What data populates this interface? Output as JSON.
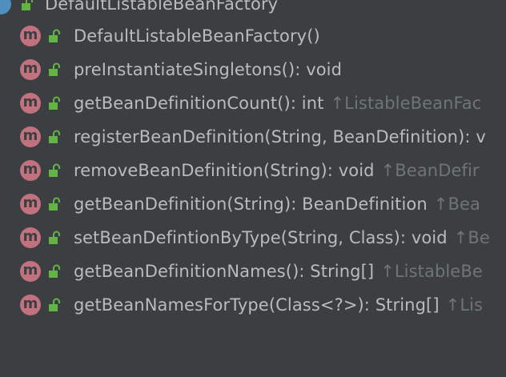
{
  "class_node": {
    "name": "DefaultListableBeanFactory",
    "icon": "class-icon"
  },
  "members": [
    {
      "signature": "DefaultListableBeanFactory()",
      "inherited": ""
    },
    {
      "signature": "preInstantiateSingletons(): void",
      "inherited": ""
    },
    {
      "signature": "getBeanDefinitionCount(): int",
      "inherited": "↑ListableBeanFac"
    },
    {
      "signature": "registerBeanDefinition(String, BeanDefinition): v",
      "inherited": ""
    },
    {
      "signature": "removeBeanDefinition(String): void",
      "inherited": "↑BeanDefir"
    },
    {
      "signature": "getBeanDefinition(String): BeanDefinition",
      "inherited": "↑Bea"
    },
    {
      "signature": "setBeanDefintionByType(String, Class): void",
      "inherited": "↑Be"
    },
    {
      "signature": "getBeanDefinitionNames(): String[]",
      "inherited": "↑ListableBe"
    },
    {
      "signature": "getBeanNamesForType(Class<?>): String[]",
      "inherited": "↑Lis"
    }
  ],
  "method_icon_letter": "m",
  "colors": {
    "background": "#3c3f41",
    "text": "#bbbbbb",
    "inherited_text": "#6f7475",
    "method_badge": "#c2727f",
    "lock_green": "#62b543",
    "class_badge": "#4e8fc0"
  }
}
